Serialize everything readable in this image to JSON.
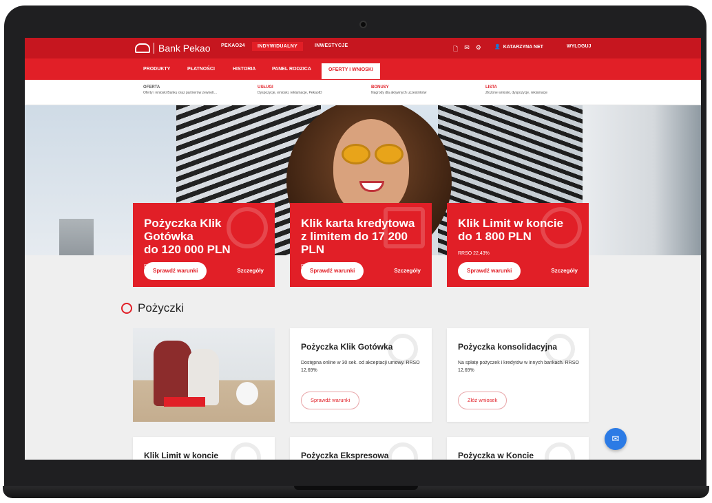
{
  "brand": {
    "name": "Bank Pekao"
  },
  "top_tabs": [
    {
      "label": "PEKAO24",
      "active": false
    },
    {
      "label": "INDYWIDUALNY",
      "active": true
    },
    {
      "label": "INWESTYCJE",
      "active": false
    }
  ],
  "top_icons": [
    "document-icon",
    "mail-icon",
    "settings-icon",
    "user-icon"
  ],
  "user": {
    "name": "KATARZYNA NET"
  },
  "logout_label": "WYLOGUJ",
  "main_nav": [
    {
      "label": "PRODUKTY"
    },
    {
      "label": "PŁATNOŚCI"
    },
    {
      "label": "HISTORIA"
    },
    {
      "label": "PANEL RODZICA"
    },
    {
      "label": "OFERTY I WNIOSKI",
      "active": true
    }
  ],
  "sub_nav": [
    {
      "title": "OFERTA",
      "desc": "Oferty i wnioski Banku oraz partnerów zewnętr..."
    },
    {
      "title": "USŁUGI",
      "desc": "Dyspozycje, wnioski, reklamacje, PekaoID"
    },
    {
      "title": "BONUSY",
      "desc": "Nagrody dla aktywnych uczestników"
    },
    {
      "title": "LISTA",
      "desc": "Złożone wnioski, dyspozycje, reklamacje"
    }
  ],
  "promos": [
    {
      "title_line1": "Pożyczka Klik Gotówka",
      "title_line2": "do 120 000 PLN",
      "rrso": "RRSO 12,69%",
      "button": "Sprawdź warunki",
      "link": "Szczegóły"
    },
    {
      "title_line1": "Klik karta kredytowa",
      "title_line2": "z limitem do 17 200 PLN",
      "rrso": "RRSO 19,98%",
      "button": "Sprawdź warunki",
      "link": "Szczegóły"
    },
    {
      "title_line1": "Klik Limit w koncie",
      "title_line2": "do 1 800 PLN",
      "rrso": "RRSO 22,43%",
      "button": "Sprawdź warunki",
      "link": "Szczegóły"
    }
  ],
  "section": {
    "title": "Pożyczki"
  },
  "cards": [
    {
      "title": "Pożyczka Klik Gotówka",
      "desc": "Dostępna online w 30 sek. od akceptacji umowy. RRSO 12,69%",
      "button": "Sprawdź warunki"
    },
    {
      "title": "Pożyczka konsolidacyjna",
      "desc": "Na spłatę pożyczek i kredytów w innych bankach. RRSO 12,69%",
      "button": "Złóż wniosek"
    }
  ],
  "bottom_cards": [
    {
      "title": "Klik Limit w koncie"
    },
    {
      "title": "Pożyczka Ekspresowa"
    },
    {
      "title": "Pożyczka w Koncie"
    }
  ],
  "chat_icon": "chat-icon",
  "colors": {
    "brand_red": "#e11f27",
    "dark_red": "#c6161f",
    "chat_blue": "#2c7be5"
  }
}
